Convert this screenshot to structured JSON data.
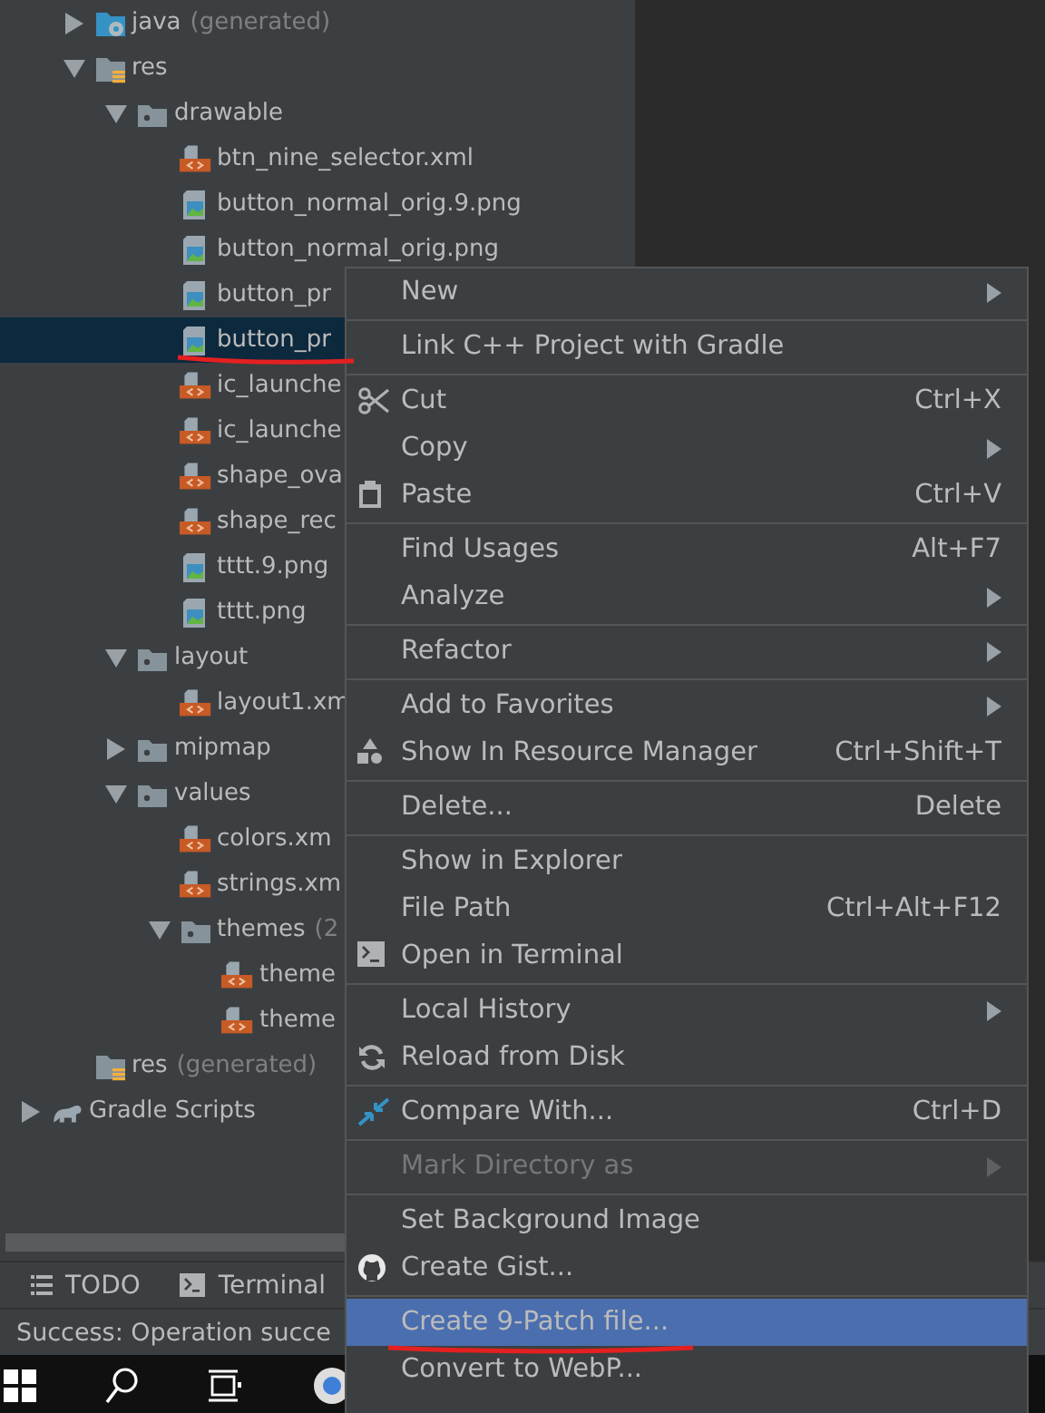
{
  "project_tree": [
    {
      "label": "java",
      "hint": "(generated)",
      "kind": "source-folder",
      "expanded": false,
      "selected": false
    },
    {
      "label": "res",
      "kind": "res-folder",
      "expanded": true,
      "selected": false,
      "children": [
        {
          "label": "drawable",
          "kind": "folder",
          "expanded": true,
          "selected": false,
          "children": [
            {
              "label": "btn_nine_selector.xml",
              "kind": "xml",
              "selected": false
            },
            {
              "label": "button_normal_orig.9.png",
              "kind": "image",
              "selected": false
            },
            {
              "label": "button_normal_orig.png",
              "kind": "image",
              "selected": false
            },
            {
              "label": "button_pr",
              "kind": "image",
              "selected": false
            },
            {
              "label": "button_pr",
              "kind": "image",
              "selected": true
            },
            {
              "label": "ic_launche",
              "kind": "xml",
              "selected": false
            },
            {
              "label": "ic_launche",
              "kind": "xml",
              "selected": false
            },
            {
              "label": "shape_ova",
              "kind": "xml",
              "selected": false
            },
            {
              "label": "shape_rec",
              "kind": "xml",
              "selected": false
            },
            {
              "label": "tttt.9.png",
              "kind": "image",
              "selected": false
            },
            {
              "label": "tttt.png",
              "kind": "image",
              "selected": false
            }
          ]
        },
        {
          "label": "layout",
          "kind": "folder",
          "expanded": true,
          "selected": false,
          "children": [
            {
              "label": "layout1.xm",
              "kind": "xml",
              "selected": false
            }
          ]
        },
        {
          "label": "mipmap",
          "kind": "folder",
          "expanded": false,
          "selected": false
        },
        {
          "label": "values",
          "kind": "folder",
          "expanded": true,
          "selected": false,
          "children": [
            {
              "label": "colors.xm",
              "kind": "xml",
              "selected": false
            },
            {
              "label": "strings.xm",
              "kind": "xml",
              "selected": false
            },
            {
              "label": "themes",
              "hint": "(2",
              "kind": "folder",
              "expanded": true,
              "selected": false,
              "children": [
                {
                  "label": "theme",
                  "kind": "xml",
                  "selected": false
                },
                {
                  "label": "theme",
                  "kind": "xml",
                  "selected": false
                }
              ]
            }
          ]
        }
      ]
    },
    {
      "label": "res",
      "hint": "(generated)",
      "kind": "res-folder",
      "selected": false
    },
    {
      "label": "Gradle Scripts",
      "kind": "gradle",
      "expanded": false,
      "selected": false
    }
  ],
  "tool_tabs": [
    {
      "label": "TODO",
      "kind": "list"
    },
    {
      "label": "Terminal",
      "kind": "terminal"
    }
  ],
  "status_bar": "Success: Operation succe",
  "context_menu": [
    [
      {
        "label": "New",
        "submenu": true,
        "disabled": false,
        "selected": false
      }
    ],
    [
      {
        "label": "Link C++ Project with Gradle",
        "disabled": false,
        "selected": false
      }
    ],
    [
      {
        "label": "Cut",
        "kind": "scissors",
        "shortcut": "Ctrl+X",
        "disabled": false,
        "selected": false
      },
      {
        "label": "Copy",
        "submenu": true,
        "disabled": false,
        "selected": false
      },
      {
        "label": "Paste",
        "kind": "clipboard",
        "shortcut": "Ctrl+V",
        "disabled": false,
        "selected": false
      }
    ],
    [
      {
        "label": "Find Usages",
        "shortcut": "Alt+F7",
        "disabled": false,
        "selected": false
      },
      {
        "label": "Analyze",
        "submenu": true,
        "disabled": false,
        "selected": false
      }
    ],
    [
      {
        "label": "Refactor",
        "submenu": true,
        "disabled": false,
        "selected": false
      }
    ],
    [
      {
        "label": "Add to Favorites",
        "submenu": true,
        "disabled": false,
        "selected": false
      },
      {
        "label": "Show In Resource Manager",
        "kind": "shapes",
        "shortcut": "Ctrl+Shift+T",
        "disabled": false,
        "selected": false
      }
    ],
    [
      {
        "label": "Delete...",
        "shortcut": "Delete",
        "disabled": false,
        "selected": false
      }
    ],
    [
      {
        "label": "Show in Explorer",
        "disabled": false,
        "selected": false
      },
      {
        "label": "File Path",
        "shortcut": "Ctrl+Alt+F12",
        "disabled": false,
        "selected": false
      },
      {
        "label": "Open in Terminal",
        "kind": "terminal",
        "disabled": false,
        "selected": false
      }
    ],
    [
      {
        "label": "Local History",
        "submenu": true,
        "disabled": false,
        "selected": false
      },
      {
        "label": "Reload from Disk",
        "kind": "reload",
        "disabled": false,
        "selected": false
      }
    ],
    [
      {
        "label": "Compare With...",
        "kind": "compare",
        "shortcut": "Ctrl+D",
        "disabled": false,
        "selected": false
      }
    ],
    [
      {
        "label": "Mark Directory as",
        "submenu": true,
        "disabled": true,
        "selected": false
      }
    ],
    [
      {
        "label": "Set Background Image",
        "disabled": false,
        "selected": false
      },
      {
        "label": "Create Gist...",
        "kind": "github",
        "disabled": false,
        "selected": false
      }
    ],
    [
      {
        "label": "Create 9-Patch file...",
        "disabled": false,
        "selected": true
      },
      {
        "label": "Convert to WebP...",
        "disabled": false,
        "selected": false
      }
    ]
  ]
}
